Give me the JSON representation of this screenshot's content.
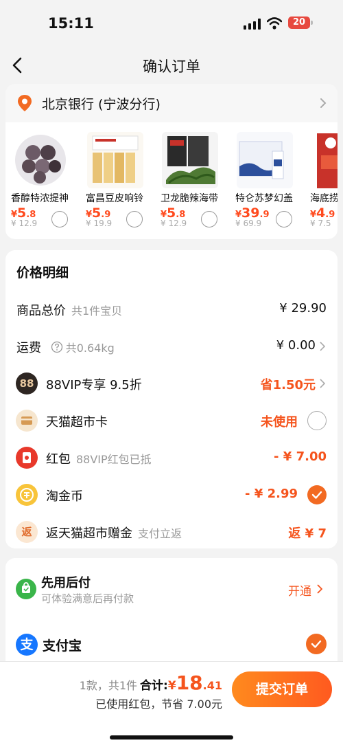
{
  "status_bar": {
    "time": "15:11",
    "battery": "20"
  },
  "nav": {
    "title": "确认订单"
  },
  "address": {
    "text": "北京银行 (宁波分行)"
  },
  "products": [
    {
      "name": "香醇特浓提神",
      "price_symbol": "¥",
      "price_int": "5",
      "price_dec": ".8",
      "orig": "¥ 12.9",
      "img_color": "#5b4a52"
    },
    {
      "name": "富昌豆皮响铃",
      "price_symbol": "¥",
      "price_int": "5",
      "price_dec": ".9",
      "orig": "¥ 19.9",
      "img_color": "#e9c77e"
    },
    {
      "name": "卫龙脆辣海带",
      "price_symbol": "¥",
      "price_int": "5",
      "price_dec": ".8",
      "orig": "¥ 12.9",
      "img_color": "#3f5e32"
    },
    {
      "name": "特仑苏梦幻盖",
      "price_symbol": "¥",
      "price_int": "39",
      "price_dec": ".9",
      "orig": "¥ 69.9",
      "img_color": "#2c4f9c"
    },
    {
      "name": "海底捞",
      "price_symbol": "¥",
      "price_int": "4",
      "price_dec": ".9",
      "orig": "¥ 7.5",
      "img_color": "#c8322a"
    }
  ],
  "price_detail": {
    "title": "价格明细",
    "goods_total": {
      "label": "商品总价",
      "sub": "共1件宝贝",
      "value": "¥ 29.90"
    },
    "shipping": {
      "label": "运费",
      "sub": "共0.64kg",
      "value": "¥ 0.00"
    },
    "vip": {
      "icon": "88",
      "label": "88VIP专享 9.5折",
      "value": "省1.50元"
    },
    "tmall_card": {
      "label": "天猫超市卡",
      "value": "未使用"
    },
    "red_packet": {
      "label": "红包",
      "sub": "88VIP红包已抵",
      "value": "- ¥ 7.00"
    },
    "taojinbi": {
      "label": "淘金币",
      "value": "- ¥ 2.99"
    },
    "rebate": {
      "icon": "返",
      "label": "返天猫超市赠金",
      "sub": "支付立返",
      "value": "返 ¥ 7"
    }
  },
  "payment": {
    "pay_later_title": "先用后付",
    "pay_later_sub": "可体验满意后再付款",
    "pay_later_action": "开通",
    "alipay_icon": "支",
    "alipay_label": "支付宝"
  },
  "bottom": {
    "count": "1款，共1件",
    "total_label": "合计:",
    "total_symbol": "¥",
    "total_int": "18",
    "total_dec": ".41",
    "saving": "已使用红包，节省 7.00元",
    "submit": "提交订单"
  },
  "colors": {
    "accent": "#f5541d",
    "button": "#ff6a1f",
    "check": "#f26a22"
  }
}
